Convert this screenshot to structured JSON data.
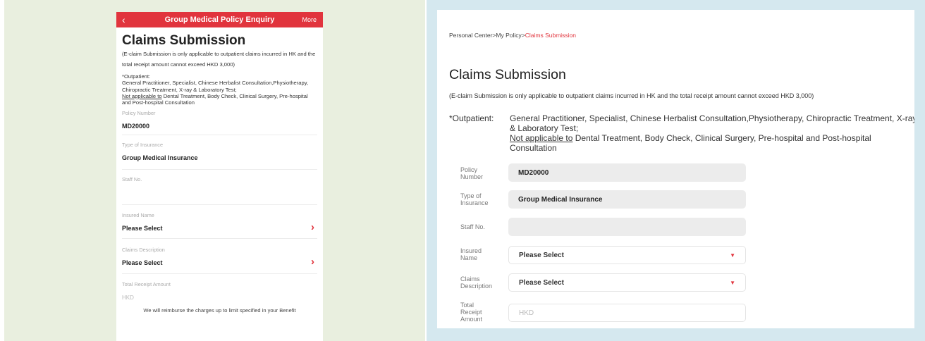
{
  "mobile": {
    "header": {
      "back_icon": "‹",
      "title": "Group Medical Policy Enquiry",
      "more": "More"
    },
    "page_title": "Claims Submission",
    "note": "(E-claim Submission is only applicable to outpatient claims incurred in HK and the total receipt amount cannot exceed HKD 3,000)",
    "outpatient_label": "*Outpatient:",
    "outpatient_text": "General Practitioner, Specialist, Chinese Herbalist Consultation,Physiotherapy, Chiropractic Treatment, X-ray & Laboratory Test;",
    "not_applicable": "Not applicable to",
    "not_applicable_text": "Dental Treatment, Body Check, Clinical Surgery, Pre-hospital and Post-hospital Consultation",
    "fields": [
      {
        "label": "Policy Number",
        "value": "MD20000"
      },
      {
        "label": "Type of Insurance",
        "value": "Group Medical Insurance"
      },
      {
        "label": "Staff No.",
        "value": ""
      },
      {
        "label": "Insured Name",
        "value": "Please Select"
      },
      {
        "label": "Claims Description",
        "value": "Please Select"
      },
      {
        "label": "Total Receipt Amount",
        "placeholder": "HKD"
      }
    ],
    "footer": "We will reimburse the charges up to limit specified in your Benefit"
  },
  "desktop": {
    "breadcrumb": {
      "personal_center": "Personal Center",
      "sep1": ">",
      "my_policy": "My Policy",
      "sep2": ">",
      "current": "Claims Submission"
    },
    "page_title": "Claims Submission",
    "note": "(E-claim Submission is only applicable to outpatient claims incurred in HK and the total receipt amount cannot exceed HKD 3,000)",
    "outpatient_label": "*Outpatient:",
    "outpatient_text": "General Practitioner, Specialist, Chinese Herbalist Consultation,Physiotherapy, Chiropractic Treatment, X-ray & Laboratory Test;",
    "not_applicable": "Not applicable to",
    "not_applicable_text": "Dental Treatment, Body Check, Clinical Surgery, Pre-hospital and Post-hospital Consultation",
    "fields": {
      "policy_number": {
        "label": "Policy Number",
        "value": "MD20000"
      },
      "type_of_insurance": {
        "label": "Type of Insurance",
        "value": "Group Medical Insurance"
      },
      "staff_no": {
        "label": "Staff No.",
        "value": ""
      },
      "insured_name": {
        "label": "Insured Name",
        "value": "Please Select",
        "caret": "▼"
      },
      "claims_description": {
        "label": "Claims Description",
        "value": "Please Select",
        "caret": "▼"
      },
      "total_receipt_amount": {
        "label": "Total Receipt Amount",
        "placeholder": "HKD"
      }
    }
  },
  "colors": {
    "accent": "#e1343d",
    "left_bg": "#e9efdf",
    "right_bg": "#d5e8ef"
  }
}
